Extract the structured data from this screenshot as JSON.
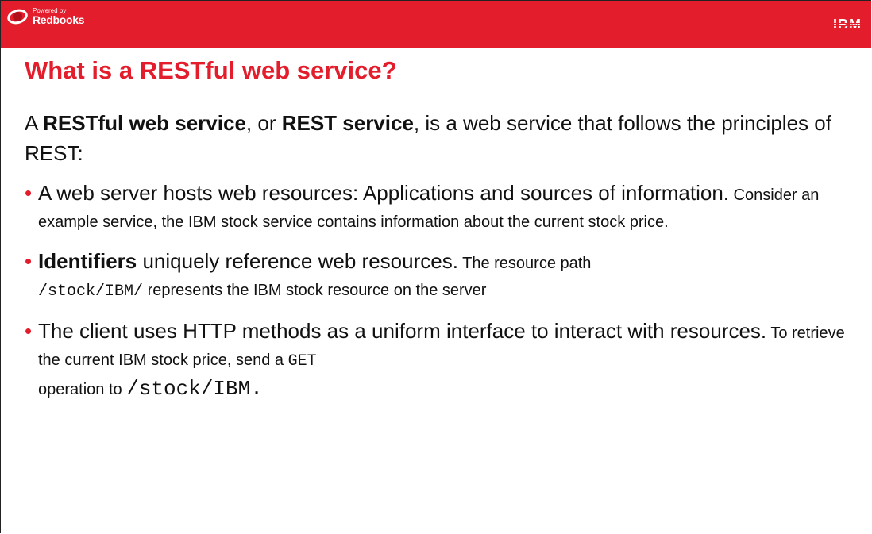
{
  "header": {
    "logo_powered": "Powered by",
    "logo_brand": "Redbooks",
    "ibm_logo_text": "IBM",
    "bar_color": "#e31d2b"
  },
  "title": "What is a RESTful web service?",
  "intro": {
    "part1": "A ",
    "bold1": "RESTful web service",
    "part2": ", or ",
    "bold2": "REST service",
    "part3": ", is a web service that follows the principles of REST:"
  },
  "bullets": [
    {
      "main": "A web server hosts web resources: Applications and sources of information.",
      "detail": " Consider an example service, the IBM stock service contains information about the current stock price."
    },
    {
      "bold": "Identifiers",
      "main": " uniquely reference web resources.",
      "detail": " The resource path ",
      "code": "/stock/IBM/",
      "detail2": " represents the IBM stock resource on the server"
    },
    {
      "main": "The client uses HTTP methods as a uniform interface to interact with resources.",
      "detail": " To retrieve the current IBM stock price, send a ",
      "code1": "GET",
      "detail2": " operation to ",
      "code2": "/stock/IBM",
      "end": "."
    }
  ],
  "bullet_glyph": "•"
}
